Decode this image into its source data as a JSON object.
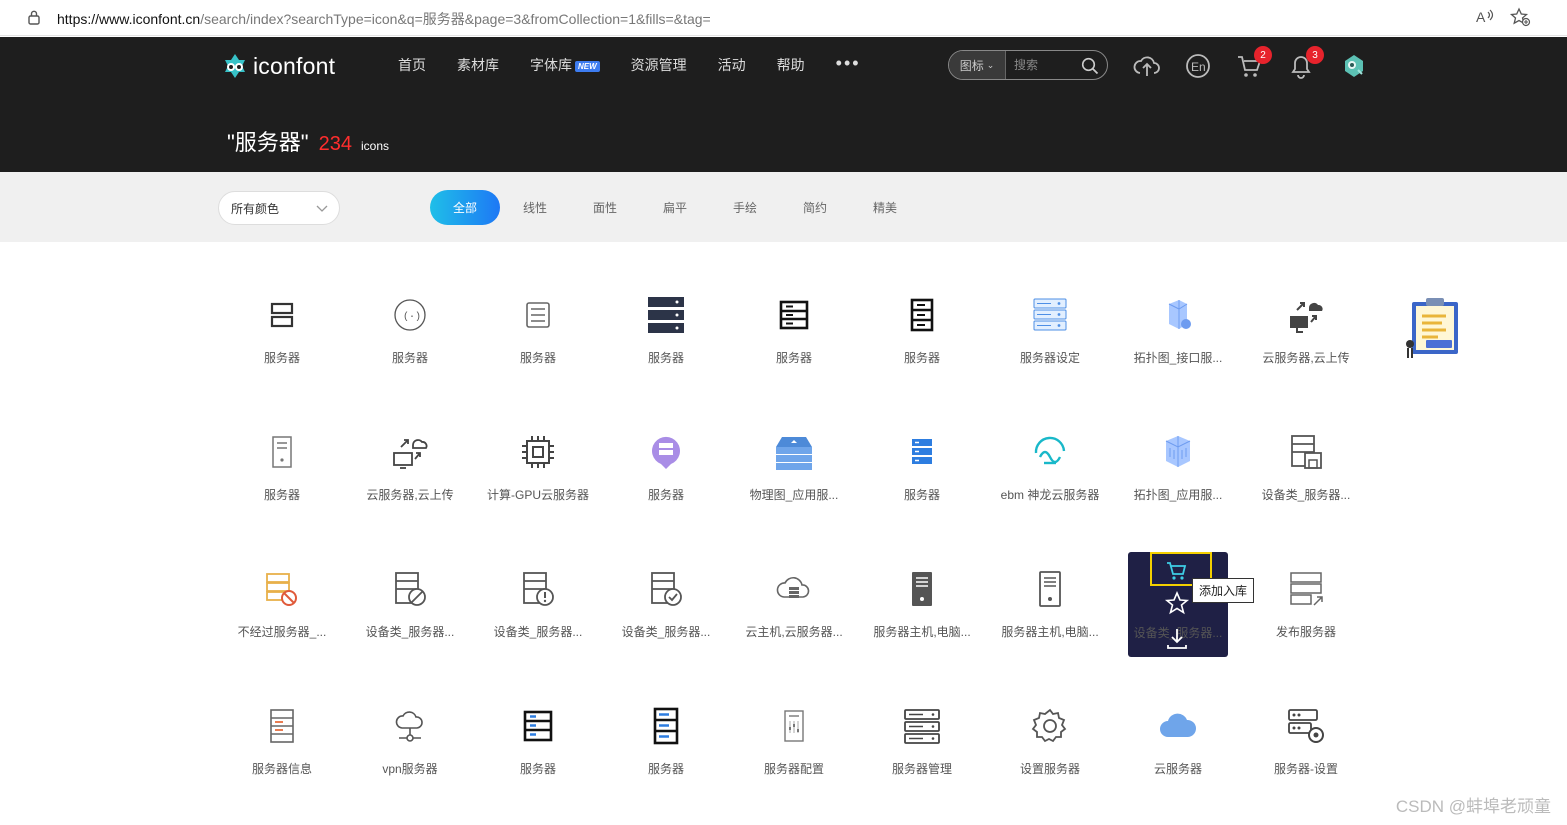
{
  "browser": {
    "url_host": "https://www.iconfont.cn",
    "url_rest": "/search/index?searchType=icon&q=服务器&page=3&fromCollection=1&fills=&tag="
  },
  "header": {
    "logo_text": "iconfont",
    "nav": [
      {
        "label": "首页"
      },
      {
        "label": "素材库"
      },
      {
        "label": "字体库",
        "badge": "NEW"
      },
      {
        "label": "资源管理"
      },
      {
        "label": "活动"
      },
      {
        "label": "帮助"
      }
    ],
    "more": "•••",
    "search_type": "图标",
    "search_placeholder": "搜索",
    "cart_count": "2",
    "notice_count": "3",
    "result_query": "\"服务器\"",
    "result_count": "234",
    "result_unit": "icons"
  },
  "filters": {
    "color_select": "所有颜色",
    "tabs": [
      "全部",
      "线性",
      "面性",
      "扁平",
      "手绘",
      "简约",
      "精美"
    ],
    "active_tab": "全部"
  },
  "grid": {
    "rows": [
      [
        "服务器",
        "服务器",
        "服务器",
        "服务器",
        "服务器",
        "服务器",
        "服务器设定",
        "拓扑图_接口服...",
        "云服务器,云上传",
        ""
      ],
      [
        "服务器",
        "云服务器,云上传",
        "计算-GPU云服务器",
        "服务器",
        "物理图_应用服...",
        "服务器",
        "ebm 神龙云服务器",
        "拓扑图_应用服...",
        "设备类_服务器..."
      ],
      [
        "不经过服务器_...",
        "设备类_服务器...",
        "设备类_服务器...",
        "设备类_服务器...",
        "云主机,云服务器...",
        "服务器主机,电脑...",
        "服务器主机,电脑...",
        "设备类_服务器...",
        "发布服务器"
      ],
      [
        "服务器信息",
        "vpn服务器",
        "服务器",
        "服务器",
        "服务器配置",
        "服务器管理",
        "设置服务器",
        "云服务器",
        "服务器-设置"
      ]
    ]
  },
  "hover": {
    "tooltip": "添加入库"
  },
  "watermark": "CSDN @蚌埠老顽童",
  "colors": {
    "header_bg": "#1e1e1e",
    "accent": "#1e78f5",
    "count_red": "#ff2d2d",
    "hover_card": "#1f2045",
    "highlight": "#f4d000"
  }
}
